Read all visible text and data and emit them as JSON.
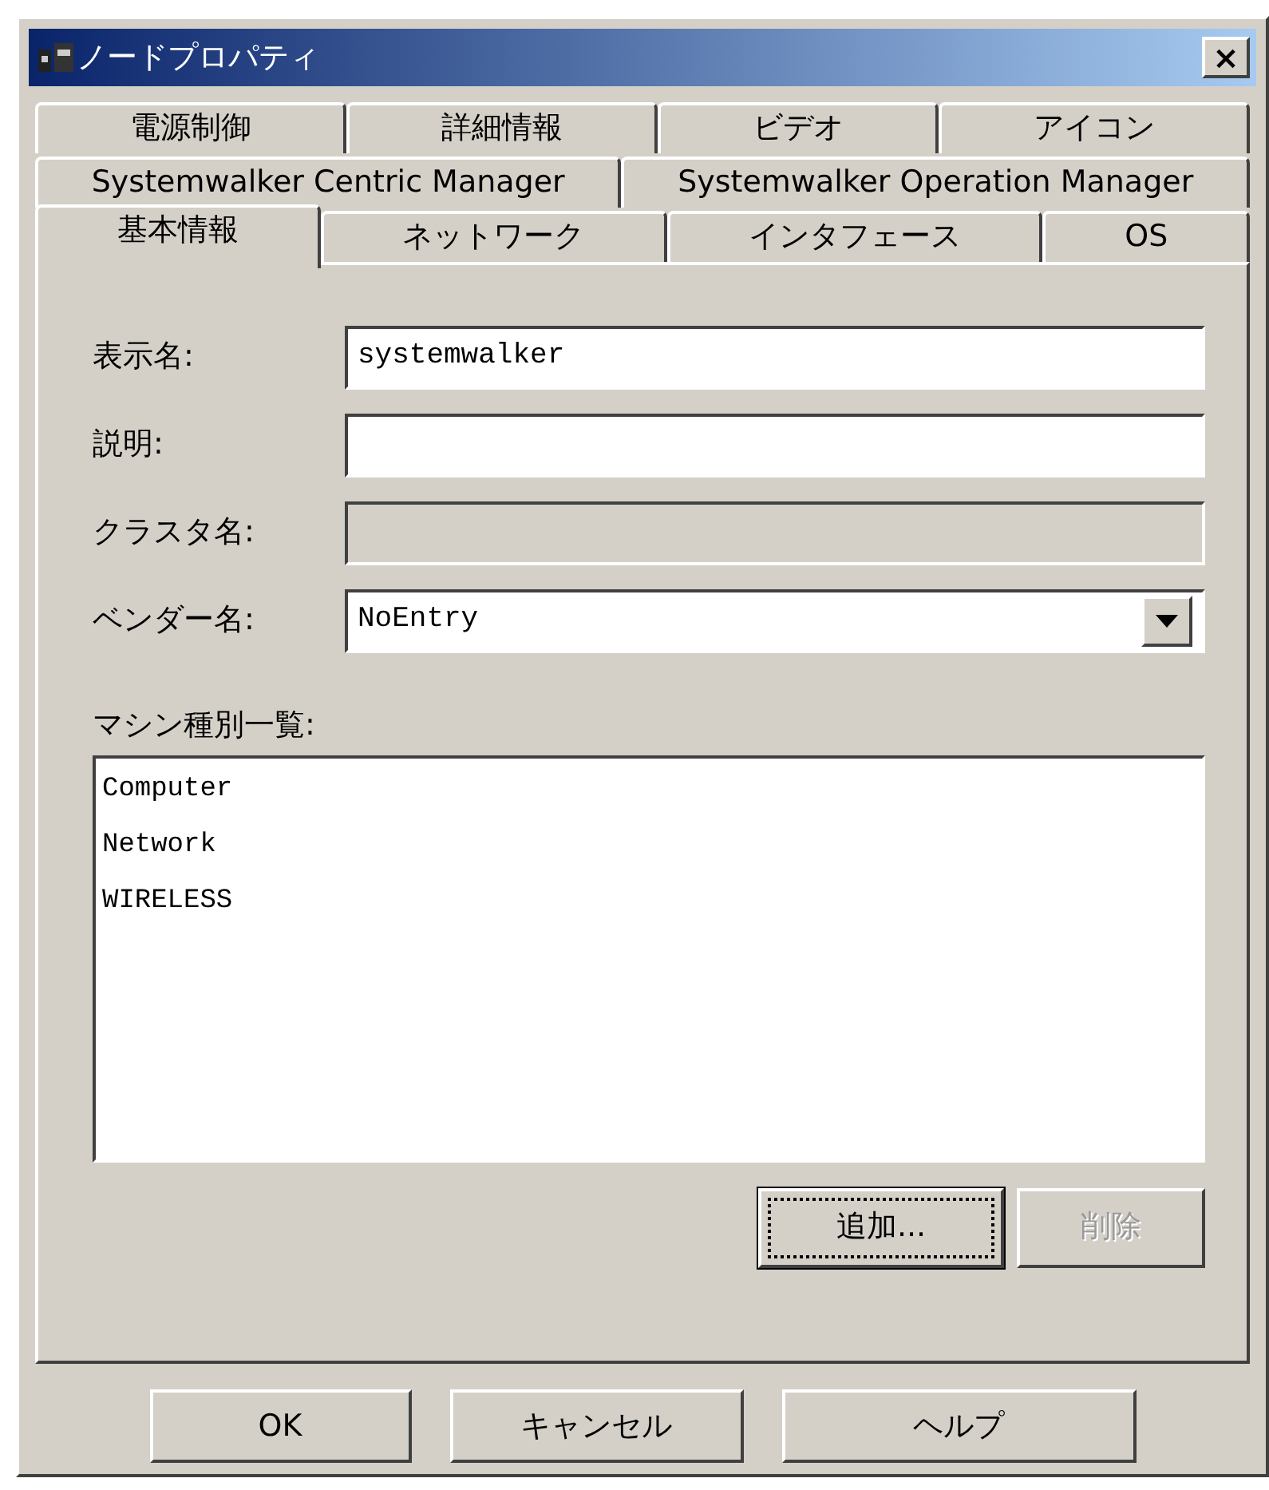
{
  "window": {
    "title": "ノードプロパティ",
    "close": "×"
  },
  "tab_rows": [
    [
      {
        "label": "電源制御",
        "selected": false
      },
      {
        "label": "詳細情報",
        "selected": false
      },
      {
        "label": "ビデオ",
        "selected": false
      },
      {
        "label": "アイコン",
        "selected": false
      }
    ],
    [
      {
        "label": "Systemwalker Centric Manager",
        "selected": false
      },
      {
        "label": "Systemwalker Operation Manager",
        "selected": false
      }
    ],
    [
      {
        "label": "基本情報",
        "selected": true
      },
      {
        "label": "ネットワーク",
        "selected": false
      },
      {
        "label": "インタフェース",
        "selected": false
      },
      {
        "label": "OS",
        "selected": false
      }
    ]
  ],
  "fields": [
    {
      "kind": "text",
      "label": "表示名:",
      "value": "systemwalker",
      "disabled": false
    },
    {
      "kind": "text",
      "label": "説明:",
      "disabled": false
    },
    {
      "kind": "text",
      "label": "クラスタ名:",
      "disabled": true
    },
    {
      "kind": "combo",
      "label": "ベンダー名:",
      "value": "NoEntry",
      "disabled": false
    }
  ],
  "machine_list": {
    "label": "マシン種別一覧:",
    "items": [
      "Computer",
      "Network",
      "WIRELESS"
    ]
  },
  "list_buttons": [
    {
      "label": "追加...",
      "focused": true,
      "disabled": false
    },
    {
      "label": "削除",
      "focused": false,
      "disabled": true
    }
  ],
  "dialog_buttons": [
    {
      "label": "OK"
    },
    {
      "label": "キャンセル"
    },
    {
      "label": "ヘルプ"
    }
  ]
}
